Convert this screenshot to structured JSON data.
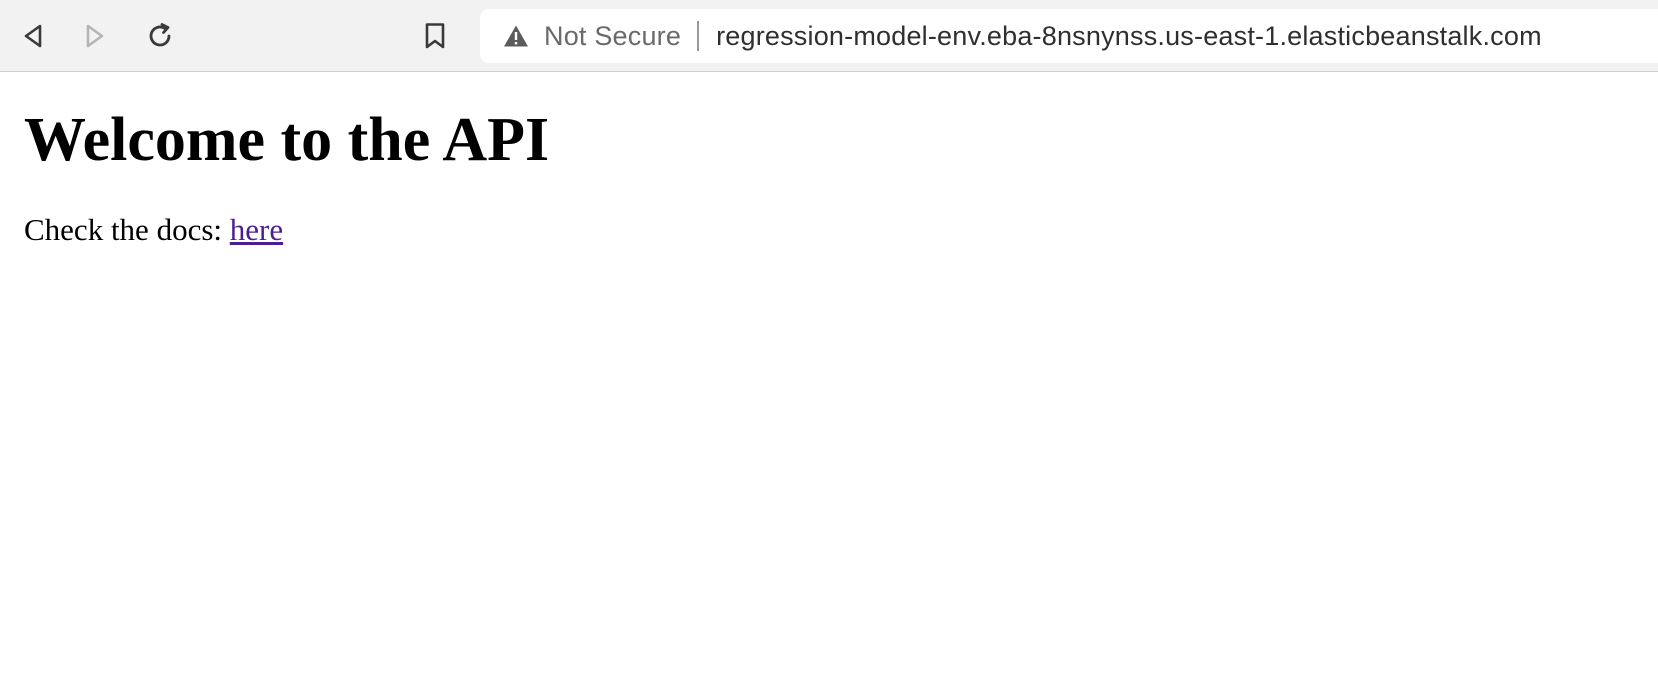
{
  "browser": {
    "icons": {
      "back": "back-arrow-icon",
      "forward": "forward-arrow-icon",
      "reload": "reload-icon",
      "bookmark": "bookmark-icon",
      "security": "warning-triangle-icon"
    },
    "address_bar": {
      "security_label": "Not Secure",
      "url": "regression-model-env.eba-8nsnynss.us-east-1.elasticbeanstalk.com"
    },
    "colors": {
      "toolbar_bg": "#f2f2f2",
      "forward_disabled": "#b5b5b5",
      "link_visited": "#4b1e96"
    }
  },
  "page": {
    "heading": "Welcome to the API",
    "docs_text": "Check the docs: ",
    "docs_link_label": "here"
  }
}
